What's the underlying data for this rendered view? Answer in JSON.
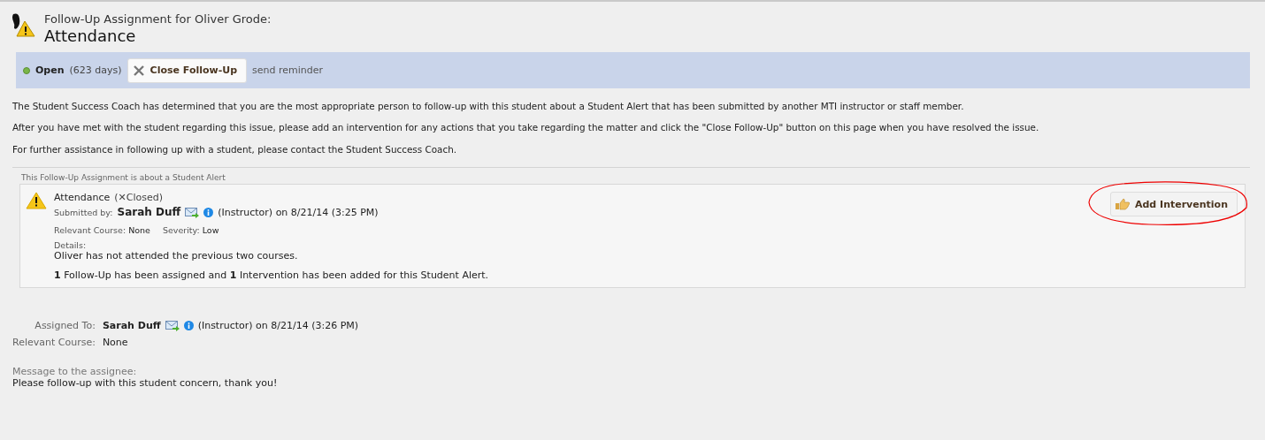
{
  "header": {
    "subtitle": "Follow-Up Assignment for Oliver Grode:",
    "title": "Attendance"
  },
  "status_bar": {
    "status": "Open",
    "days": "(623 days)",
    "close_button": "Close Follow-Up",
    "reminder_link": "send reminder"
  },
  "paragraphs": [
    "The Student Success Coach has determined that you are the most appropriate person to follow-up with this student about a Student Alert that has been submitted by another MTI instructor or staff member.",
    "After you have met with the student regarding this issue, please add an intervention for any actions that you take regarding the matter and click the \"Close Follow-Up\" button on this page when you have resolved the issue.",
    "For further assistance in following up with a student, please contact the Student Success Coach."
  ],
  "alert": {
    "caption": "This Follow-Up Assignment is about a Student Alert",
    "title": "Attendance",
    "status": "(✕Closed)",
    "submitted_label": "Submitted by:",
    "submitted_name": "Sarah Duff",
    "submitted_info": "(Instructor) on 8/21/14 (3:25 PM)",
    "fields": [
      {
        "label": "Relevant Course:",
        "value": "None"
      },
      {
        "label": "Severity:",
        "value": "Low"
      }
    ],
    "details_label": "Details:",
    "details": "Oliver has not attended the previous two courses.",
    "summary": "**1** Follow-Up has been assigned and **1** Intervention has been added for this Student Alert.",
    "add_button": "Add Intervention"
  },
  "assignment": {
    "assigned_label": "Assigned To:",
    "assigned_name": "Sarah Duff",
    "assigned_info": "(Instructor) on 8/21/14 (3:26 PM)",
    "course_label": "Relevant Course:",
    "course_value": "None",
    "message_label": "Message to the assignee:",
    "message": "Please follow-up with this student concern, thank you!"
  }
}
